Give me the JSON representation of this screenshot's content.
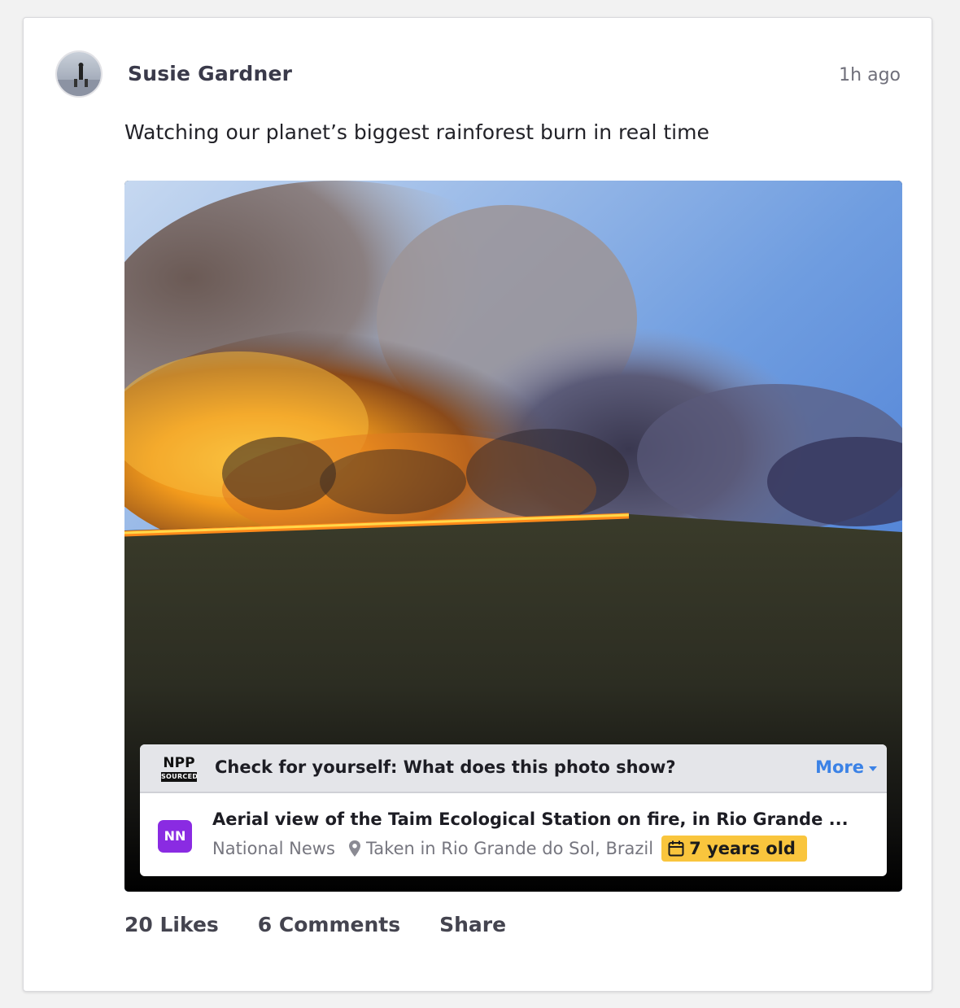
{
  "post": {
    "author": "Susie Gardner",
    "timestamp": "1h ago",
    "caption": "Watching our planet’s biggest rainforest burn in real time"
  },
  "factcheck": {
    "logo_top": "NPP",
    "logo_bottom": "SOURCED",
    "question": "Check for yourself: What does this photo show?",
    "more_label": "More",
    "source_logo": "NN",
    "source_title": "Aerial view of the Taim Ecological Station on fire, in Rio Grande ...",
    "source_name": "National News",
    "location": "Taken in Rio Grande do Sol, Brazil",
    "age": "7 years old"
  },
  "actions": {
    "likes": "20 Likes",
    "comments": "6 Comments",
    "share": "Share"
  },
  "colors": {
    "accent": "#3b82e6",
    "badge": "#f9c53d",
    "source_logo": "#8a2be2"
  },
  "icons": [
    "map-pin-icon",
    "calendar-icon",
    "chevron-down-icon"
  ]
}
